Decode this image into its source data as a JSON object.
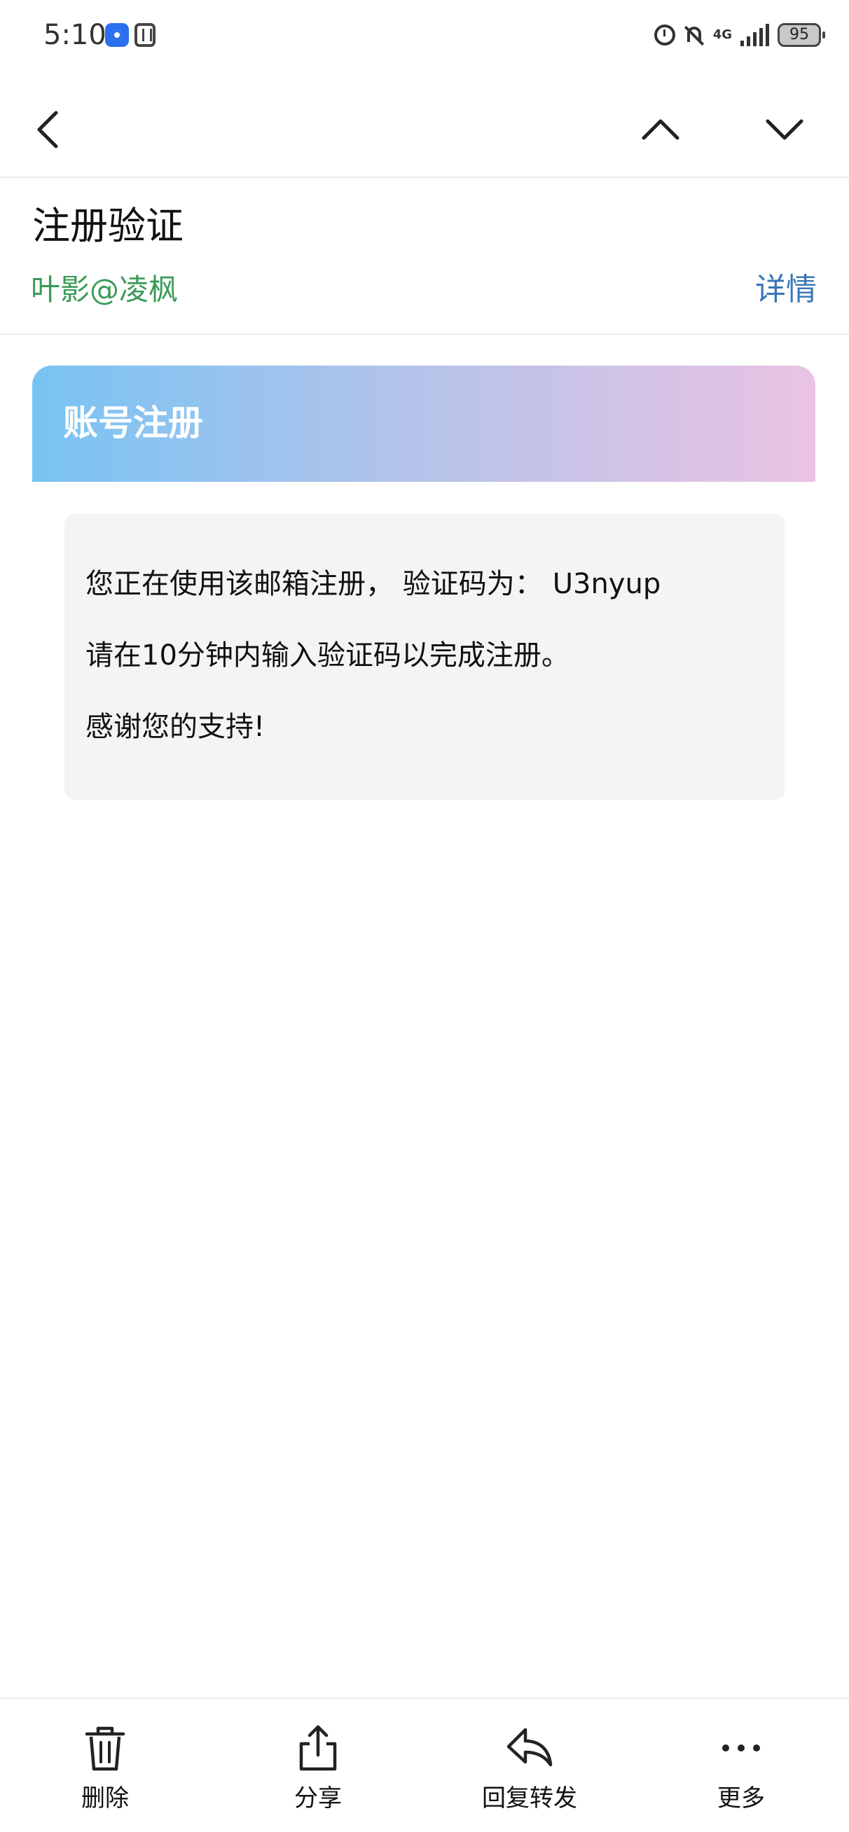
{
  "status_bar": {
    "time": "5:10",
    "network": "4G",
    "battery": "95"
  },
  "nav": {
    "back_icon": "chevron-left-icon",
    "prev_icon": "chevron-up-icon",
    "next_icon": "chevron-down-icon"
  },
  "email": {
    "subject": "注册验证",
    "sender": "叶影@凌枫",
    "details_label": "详情",
    "banner_title": "账号注册",
    "body": {
      "line1_text": "您正在使用该邮箱注册， 验证码为：",
      "verification_code": "U3nyup",
      "line2": "请在10分钟内输入验证码以完成注册。",
      "line3": "感谢您的支持!"
    }
  },
  "bottom_bar": {
    "delete_label": "删除",
    "share_label": "分享",
    "reply_forward_label": "回复转发",
    "more_label": "更多"
  },
  "colors": {
    "sender": "#3b9b57",
    "details": "#3a78b5",
    "banner_gradient_start": "#78c3f3",
    "banner_gradient_end": "#eac3e3",
    "content_bg": "#f4f4f4"
  }
}
